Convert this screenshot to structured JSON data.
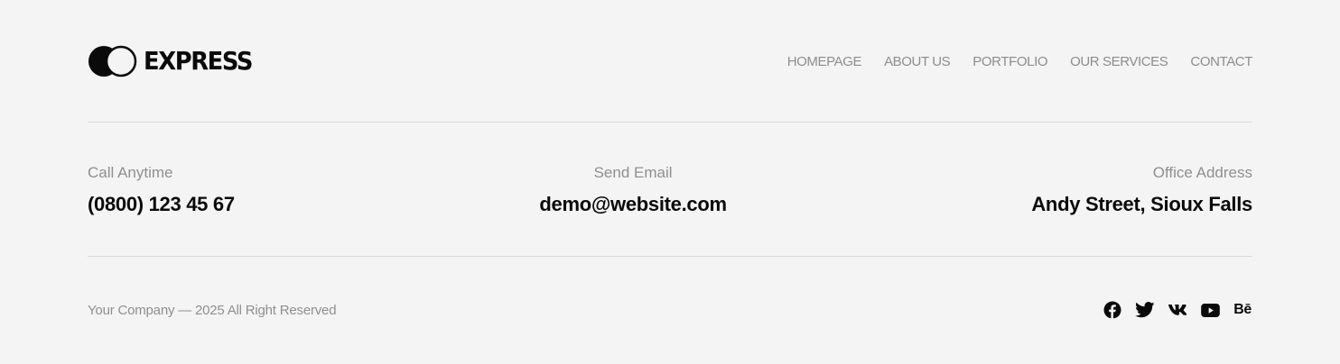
{
  "logo": {
    "text": "EXPRESS",
    "icon": "two-circles-logo-icon"
  },
  "nav": {
    "items": [
      {
        "label": "HOMEPAGE"
      },
      {
        "label": "ABOUT US"
      },
      {
        "label": "PORTFOLIO"
      },
      {
        "label": "OUR SERVICES"
      },
      {
        "label": "CONTACT"
      }
    ]
  },
  "contacts": {
    "phone": {
      "label": "Call Anytime",
      "value": "(0800) 123 45 67"
    },
    "email": {
      "label": "Send Email",
      "value": "demo@website.com"
    },
    "address": {
      "label": "Office Address",
      "value": "Andy Street, Sioux Falls"
    }
  },
  "footer": {
    "copyright": "Your Company — 2025 All Right Reserved"
  },
  "social": {
    "icons": [
      "facebook-icon",
      "twitter-icon",
      "vk-icon",
      "youtube-icon",
      "behance-icon"
    ],
    "behance_text": "Bē"
  },
  "colors": {
    "background": "#f4f4f4",
    "text_dark": "#0a0a0a",
    "text_muted": "#8f8f8f",
    "divider": "#dadada"
  }
}
